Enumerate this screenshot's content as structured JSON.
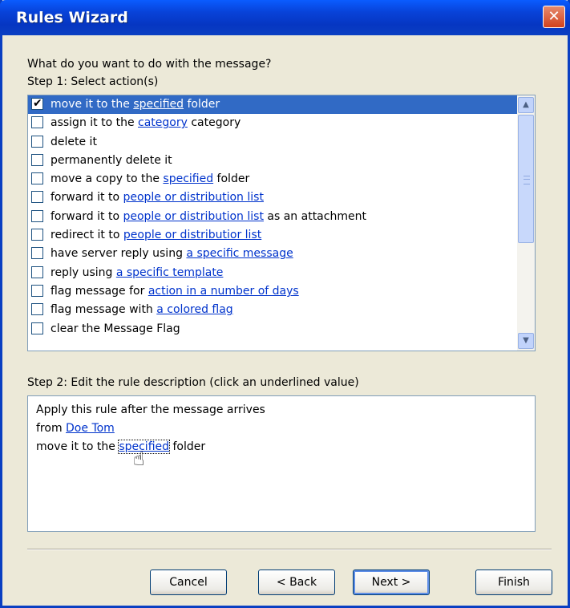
{
  "window": {
    "title": "Rules Wizard",
    "close_icon": "close-icon"
  },
  "prompt": "What do you want to do with the message?",
  "step1_label": "Step 1: Select action(s)",
  "actions": [
    {
      "checked": true,
      "parts": [
        {
          "t": "move it to the "
        },
        {
          "t": "specified",
          "link": true
        },
        {
          "t": " folder"
        }
      ]
    },
    {
      "checked": false,
      "parts": [
        {
          "t": "assign it to the "
        },
        {
          "t": "category",
          "link": true
        },
        {
          "t": " category"
        }
      ]
    },
    {
      "checked": false,
      "parts": [
        {
          "t": "delete it"
        }
      ]
    },
    {
      "checked": false,
      "parts": [
        {
          "t": "permanently delete it"
        }
      ]
    },
    {
      "checked": false,
      "parts": [
        {
          "t": "move a copy to the "
        },
        {
          "t": "specified",
          "link": true
        },
        {
          "t": " folder"
        }
      ]
    },
    {
      "checked": false,
      "parts": [
        {
          "t": "forward it to "
        },
        {
          "t": "people or distribution list",
          "link": true
        }
      ]
    },
    {
      "checked": false,
      "parts": [
        {
          "t": "forward it to "
        },
        {
          "t": "people or distribution list",
          "link": true
        },
        {
          "t": " as an attachment"
        }
      ]
    },
    {
      "checked": false,
      "parts": [
        {
          "t": "redirect it to "
        },
        {
          "t": "people or distributior list",
          "link": true
        }
      ]
    },
    {
      "checked": false,
      "parts": [
        {
          "t": "have server reply using "
        },
        {
          "t": "a specific message",
          "link": true
        }
      ]
    },
    {
      "checked": false,
      "parts": [
        {
          "t": "reply using "
        },
        {
          "t": "a specific template",
          "link": true
        }
      ]
    },
    {
      "checked": false,
      "parts": [
        {
          "t": "flag message for "
        },
        {
          "t": "action in a number of days",
          "link": true
        }
      ]
    },
    {
      "checked": false,
      "parts": [
        {
          "t": "flag message with "
        },
        {
          "t": "a colored flag",
          "link": true
        }
      ]
    },
    {
      "checked": false,
      "parts": [
        {
          "t": "clear the Message Flag"
        }
      ]
    }
  ],
  "step2_label": "Step 2: Edit the rule description (click an underlined value)",
  "description": {
    "line1": "Apply this rule after the message arrives",
    "line2_prefix": "from ",
    "line2_link": "Doe Tom",
    "line3_prefix": "move it to the ",
    "line3_link": "specified",
    "line3_suffix": " folder"
  },
  "buttons": {
    "cancel": "Cancel",
    "back": "< Back",
    "next": "Next >",
    "finish": "Finish"
  },
  "colors": {
    "titlebar": "#0842d8",
    "selection": "#316ac5",
    "link": "#0033cc",
    "dialog_bg": "#ece9d8"
  }
}
